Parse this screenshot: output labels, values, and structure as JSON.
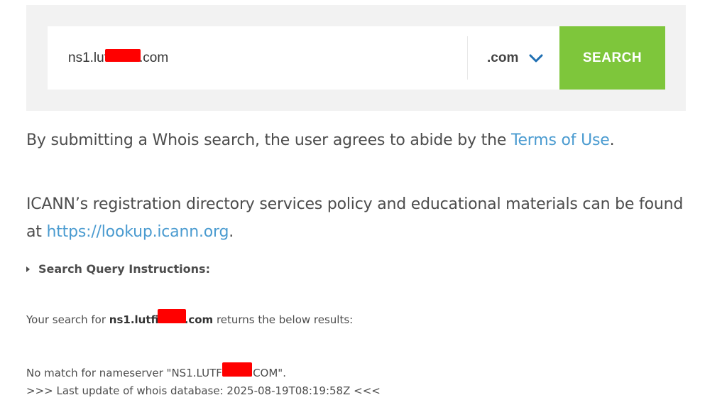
{
  "search": {
    "query_value": "ns1.lutfi███.com",
    "query_visible_prefix": "ns1.lut",
    "query_visible_suffix": ".com",
    "tld_value": ".com",
    "button_label": "SEARCH"
  },
  "terms": {
    "prefix": "By submitting a Whois search, the user agrees to abide by the ",
    "link_label": "Terms of Use",
    "suffix": "."
  },
  "policy": {
    "prefix": "ICANN’s registration directory services policy and educational materials can be found at ",
    "link_label": "https://lookup.icann.org",
    "suffix": "."
  },
  "instructions": {
    "label": "Search Query Instructions:"
  },
  "result": {
    "summary_prefix": "Your search for ",
    "summary_query_prefix": "ns1.lutfi",
    "summary_query_suffix": ".com",
    "summary_suffix": " returns the below results:",
    "no_match_prefix": "No match for nameserver \"NS1.LUTFI",
    "no_match_suffix": ".COM\".",
    "last_update": ">>> Last update of whois database: 2025-08-19T08:19:58Z <<<"
  },
  "colors": {
    "accent_green": "#7ec63b",
    "link_blue": "#4a9bd0",
    "redaction_red": "#ff0000",
    "chevron_blue": "#1f6fb2"
  },
  "icons": {
    "dropdown": "chevron-down-icon",
    "expand": "caret-right-icon"
  }
}
